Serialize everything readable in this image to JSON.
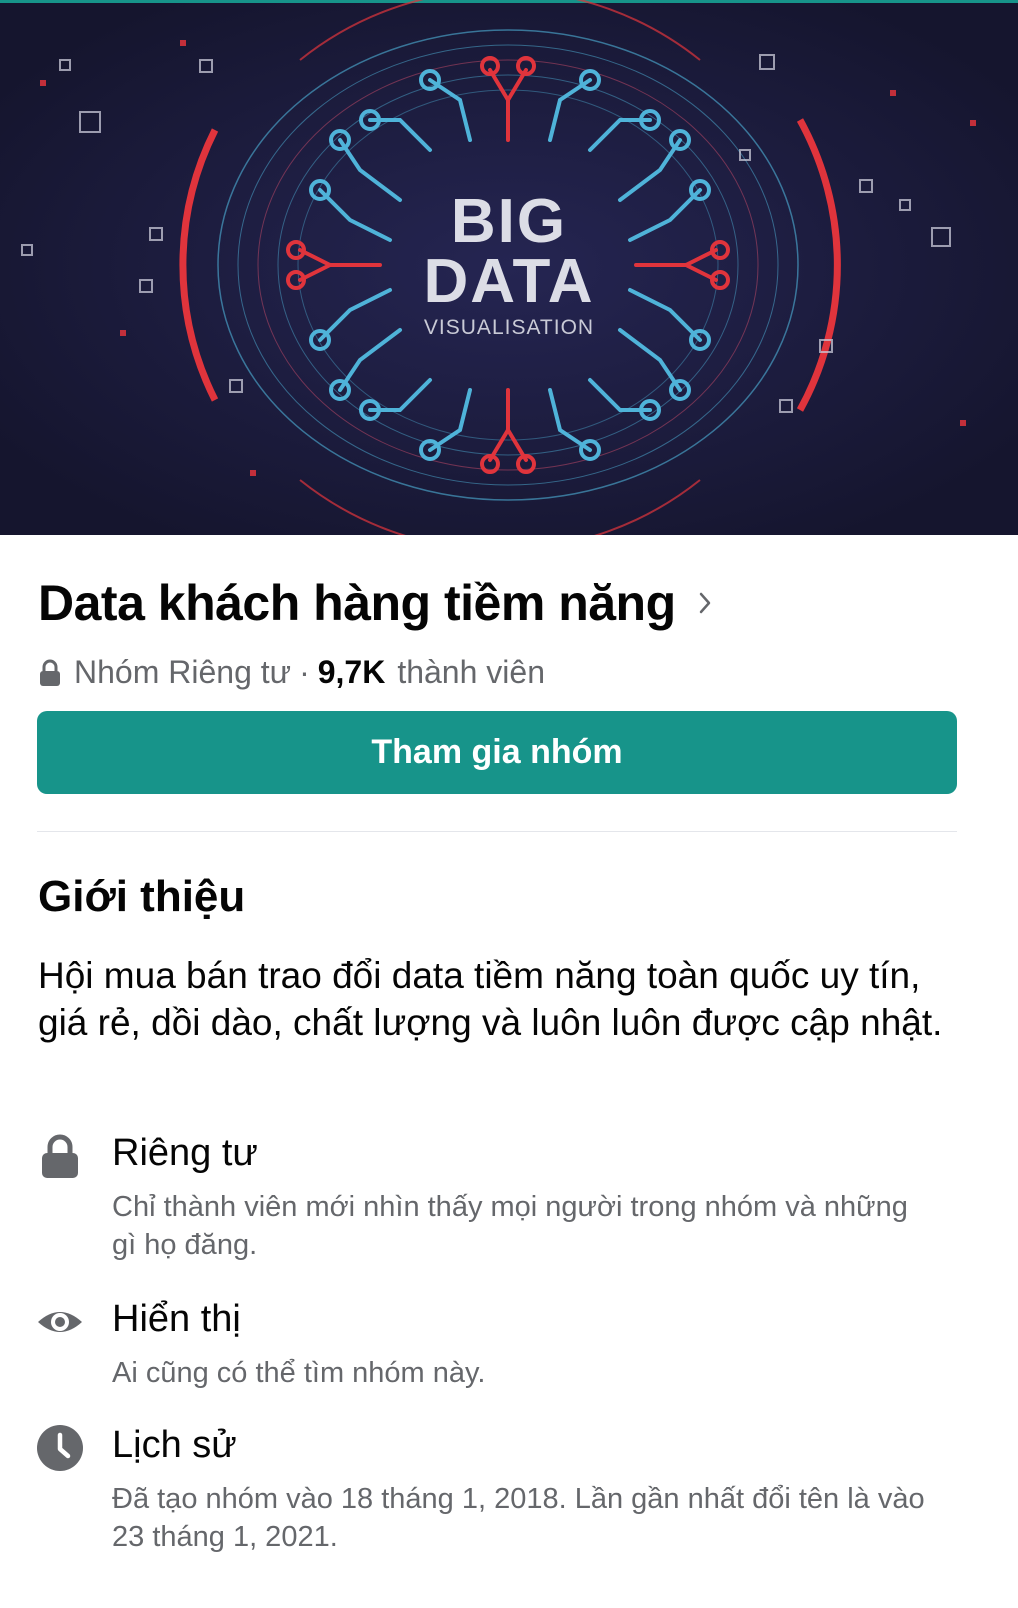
{
  "cover": {
    "line1": "BIG",
    "line2": "DATA",
    "line3": "VISUALISATION"
  },
  "group": {
    "title": "Data khách hàng tiềm năng",
    "privacy_label": "Nhóm Riêng tư",
    "separator": "·",
    "member_count": "9,7K",
    "member_label": "thành viên"
  },
  "join_button": {
    "label": "Tham gia nhóm"
  },
  "about": {
    "heading": "Giới thiệu",
    "description": "Hội mua bán trao đổi data tiềm năng toàn quốc uy tín, giá rẻ, dồi dào, chất lượng và luôn luôn được cập nhật.",
    "items": [
      {
        "icon": "lock-icon",
        "title": "Riêng tư",
        "subtitle": "Chỉ thành viên mới nhìn thấy mọi người trong nhóm và những gì họ đăng."
      },
      {
        "icon": "eye-icon",
        "title": "Hiển thị",
        "subtitle": "Ai cũng có thể tìm nhóm này."
      },
      {
        "icon": "clock-icon",
        "title": "Lịch sử",
        "subtitle": "Đã tạo nhóm vào 18 tháng 1, 2018. Lần gần nhất đổi tên là vào 23 tháng 1, 2021."
      }
    ]
  },
  "colors": {
    "accent": "#17948a",
    "cover_bg": "#1a1a3a",
    "circuit_blue": "#4fb3d9",
    "circuit_red": "#e0343c",
    "secondary_text": "#65676b"
  }
}
